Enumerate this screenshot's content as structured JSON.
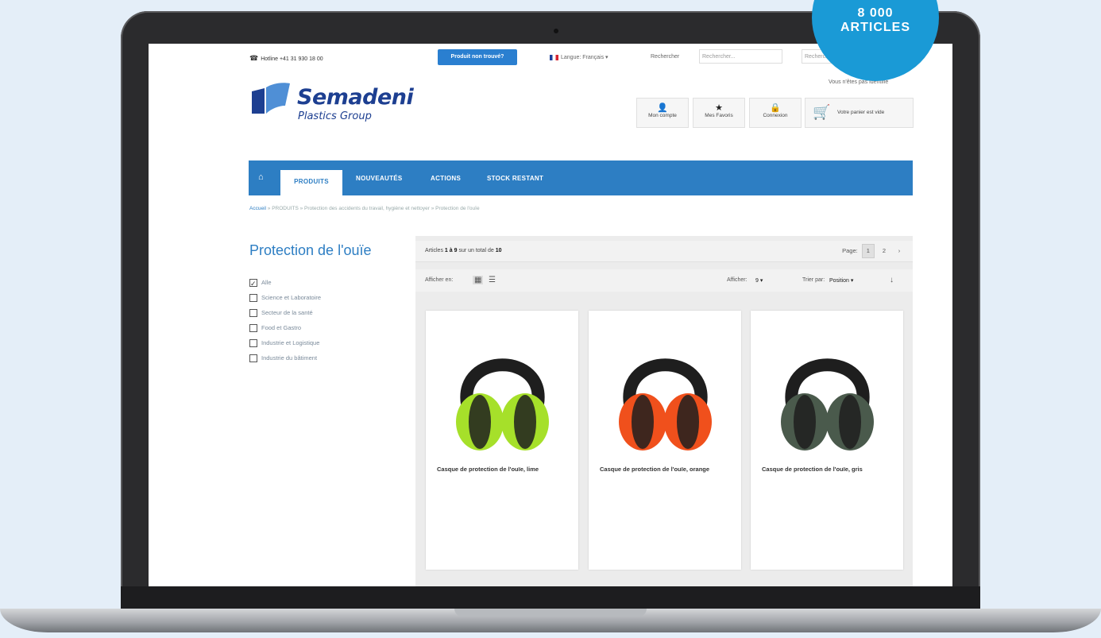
{
  "badge": {
    "line1": "8 000",
    "line2": "ARTICLES"
  },
  "topbar": {
    "hotline": "Hotline +41 31 930 18 00",
    "product_not_found": "Produit non trouvé?",
    "language": "Langue: Français",
    "search_label": "Rechercher",
    "search_placeholder": "Rechercher...",
    "search2_placeholder": "Rechercher...",
    "identity_status": "Vous n'êtes pas identifié"
  },
  "logo": {
    "name": "Semadeni",
    "subtitle": "Plastics Group"
  },
  "header_buttons": {
    "account": "Mon compte",
    "favorites": "Mes Favoris",
    "login": "Connexion",
    "cart": "Votre panier est vide"
  },
  "nav": {
    "items": [
      "PRODUITS",
      "NOUVEAUTÉS",
      "ACTIONS",
      "STOCK RESTANT"
    ]
  },
  "breadcrumb": {
    "home": "Accueil",
    "trail": " » PRODUITS » Protection des accidents du travail, hygiène et nettoyer » Protection de l'ouïe"
  },
  "page_title": "Protection de l'ouïe",
  "filters": [
    {
      "label": "Alle",
      "checked": true
    },
    {
      "label": "Science et Laboratoire",
      "checked": false
    },
    {
      "label": "Secteur de la santé",
      "checked": false
    },
    {
      "label": "Food et Gastro",
      "checked": false
    },
    {
      "label": "Industrie et Logistique",
      "checked": false
    },
    {
      "label": "Industrie du bâtiment",
      "checked": false
    }
  ],
  "toolbar": {
    "count_prefix": "Articles",
    "count_range": "1 à 9",
    "count_mid": "sur un total de",
    "count_total": "10",
    "page_label": "Page:",
    "pages": [
      "1",
      "2"
    ],
    "next": "›",
    "view_label": "Afficher en:",
    "show_label": "Afficher:",
    "show_value": "9",
    "sort_label": "Trier par:",
    "sort_value": "Position"
  },
  "products": [
    {
      "name": "Casque de protection de l'ouïe, lime",
      "color": "#a6e02a"
    },
    {
      "name": "Casque de protection de l'ouïe, orange",
      "color": "#f0501c"
    },
    {
      "name": "Casque de protection de l'ouïe, gris",
      "color": "#4a5a4c"
    }
  ],
  "colors": {
    "accent": "#2d7ec3",
    "badge": "#1a9ad6",
    "brand": "#1d3f91"
  }
}
